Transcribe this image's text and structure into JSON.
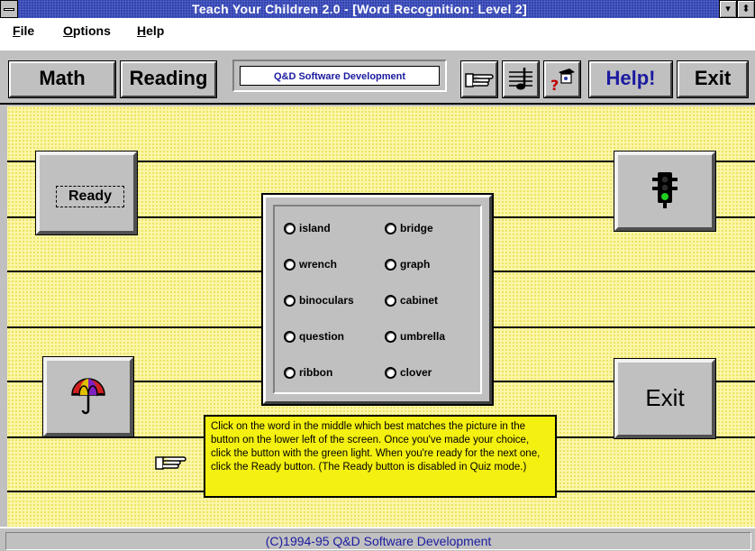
{
  "window": {
    "title": "Teach Your Children 2.0 - [Word Recognition: Level 2]",
    "minimize_glyph": "▾",
    "restore_glyph": "⬍"
  },
  "menu": [
    "File",
    "Options",
    "Help"
  ],
  "toolbar": {
    "math_label": "Math",
    "reading_label": "Reading",
    "banner_text": "Q&D Software Development",
    "help_label": "Help!",
    "exit_label": "Exit",
    "icons": [
      "hand-pointer-icon",
      "music-icon",
      "graduate-icon"
    ]
  },
  "main": {
    "ready_label": "Ready",
    "exit_label": "Exit",
    "picture_icon": "umbrella-icon",
    "go_icon": "traffic-light-icon"
  },
  "choices": {
    "left": [
      "island",
      "wrench",
      "binoculars",
      "question",
      "ribbon"
    ],
    "right": [
      "bridge",
      "graph",
      "cabinet",
      "umbrella",
      "clover"
    ]
  },
  "tooltip": {
    "text": "Click on the word in the middle which best matches the picture in the button on the lower left of the screen. Once you've made your choice, click the button with the green light. When you're ready for the next one, click the Ready button. (The Ready button is disabled in Quiz mode.)"
  },
  "status": {
    "text": "(C)1994-95 Q&D Software Development"
  },
  "colors": {
    "title_bar": "#2a3aa8",
    "work_area": "#fbf6a6",
    "tooltip_bg": "#f4f010",
    "link_blue": "#1a1aa0",
    "green_light": "#22cc22"
  }
}
